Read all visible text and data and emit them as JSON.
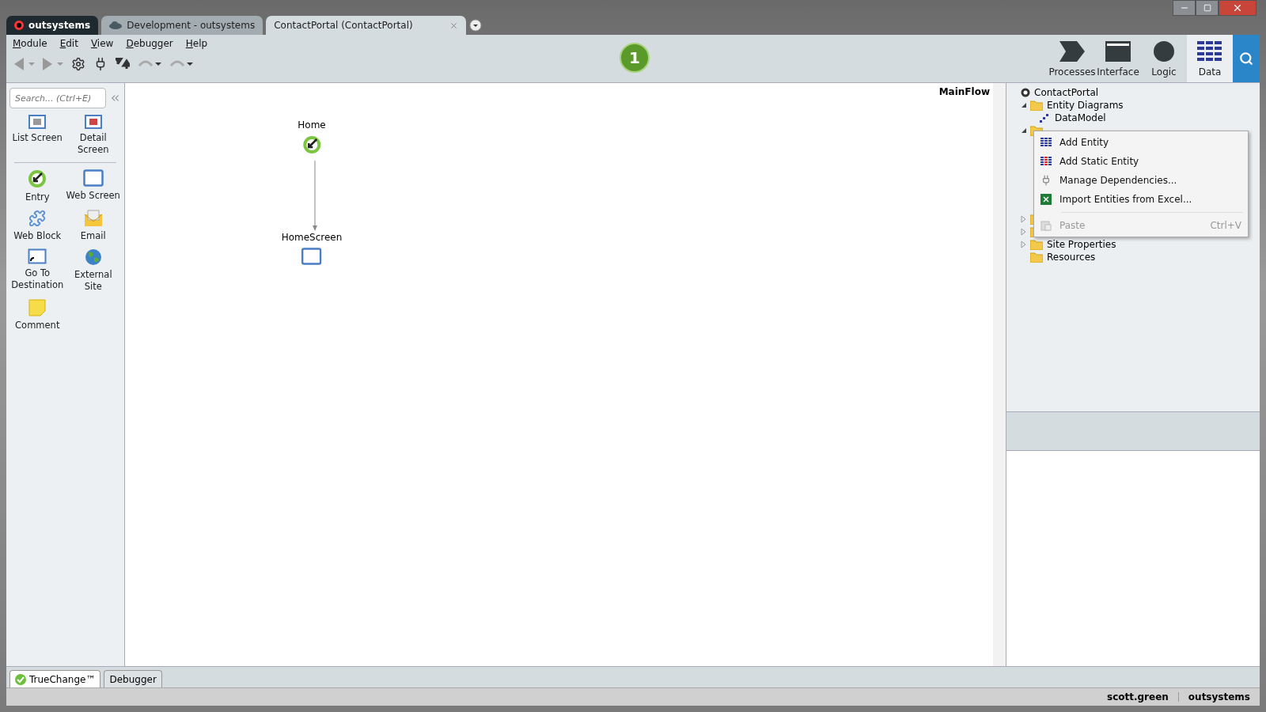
{
  "window": {
    "tabs": [
      {
        "label": "outsystems",
        "kind": "brand",
        "selected": false
      },
      {
        "label": "Development - outsystems",
        "kind": "cloud",
        "selected": false
      },
      {
        "label": "ContactPortal (ContactPortal)",
        "kind": "doc",
        "selected": true
      }
    ]
  },
  "menu": [
    "Module",
    "Edit",
    "View",
    "Debugger",
    "Help"
  ],
  "badge": "1",
  "module_tabs": [
    {
      "label": "Processes",
      "kind": "processes",
      "selected": false
    },
    {
      "label": "Interface",
      "kind": "interface",
      "selected": false
    },
    {
      "label": "Logic",
      "kind": "logic",
      "selected": false
    },
    {
      "label": "Data",
      "kind": "data",
      "selected": true
    }
  ],
  "palette": {
    "search": {
      "placeholder": "Search... (Ctrl+E)"
    },
    "groups": [
      [
        {
          "label": "List Screen",
          "kind": "list"
        },
        {
          "label": "Detail Screen",
          "kind": "detail"
        }
      ],
      [
        {
          "label": "Entry",
          "kind": "entry"
        },
        {
          "label": "Web Screen",
          "kind": "screen"
        },
        {
          "label": "Web Block",
          "kind": "block"
        },
        {
          "label": "Email",
          "kind": "email"
        },
        {
          "label": "Go To Destination",
          "kind": "goto"
        },
        {
          "label": "External Site",
          "kind": "site"
        },
        {
          "label": "Comment",
          "kind": "comment"
        }
      ]
    ]
  },
  "canvas": {
    "flow": "MainFlow",
    "nodes": [
      {
        "label": "Home",
        "kind": "entry"
      },
      {
        "label": "HomeScreen",
        "kind": "screen"
      }
    ]
  },
  "tree": [
    {
      "label": "ContactPortal",
      "kind": "module",
      "children": [
        {
          "label": "Entity Diagrams",
          "kind": "folder",
          "expanded": true,
          "children": [
            {
              "label": "DataModel",
              "kind": "diagram"
            }
          ]
        },
        {
          "kind": "folder",
          "expanded": true
        },
        {
          "kind": "folder",
          "expanded": false
        },
        {
          "kind": "folder",
          "expanded": false
        },
        {
          "label": "Site Properties",
          "kind": "folder",
          "expanded": false
        },
        {
          "label": "Resources",
          "kind": "folder"
        }
      ]
    }
  ],
  "context_menu": [
    {
      "label": "Add Entity",
      "kind": "entity",
      "disabled": false
    },
    {
      "label": "Add Static Entity",
      "kind": "static",
      "disabled": false
    },
    {
      "label": "Manage Dependencies...",
      "kind": "plug",
      "disabled": false
    },
    {
      "label": "Import Entities from Excel...",
      "kind": "excel",
      "disabled": false
    },
    {
      "label": "Paste",
      "kind": "paste",
      "shortcut": "Ctrl+V",
      "disabled": true,
      "separator_before": true
    }
  ],
  "bottom_tabs": [
    {
      "label": "TrueChange™",
      "kind": "check",
      "selected": true
    },
    {
      "label": "Debugger",
      "kind": "plain",
      "selected": false
    }
  ],
  "status": {
    "user": "scott.green",
    "server": "outsystems"
  }
}
